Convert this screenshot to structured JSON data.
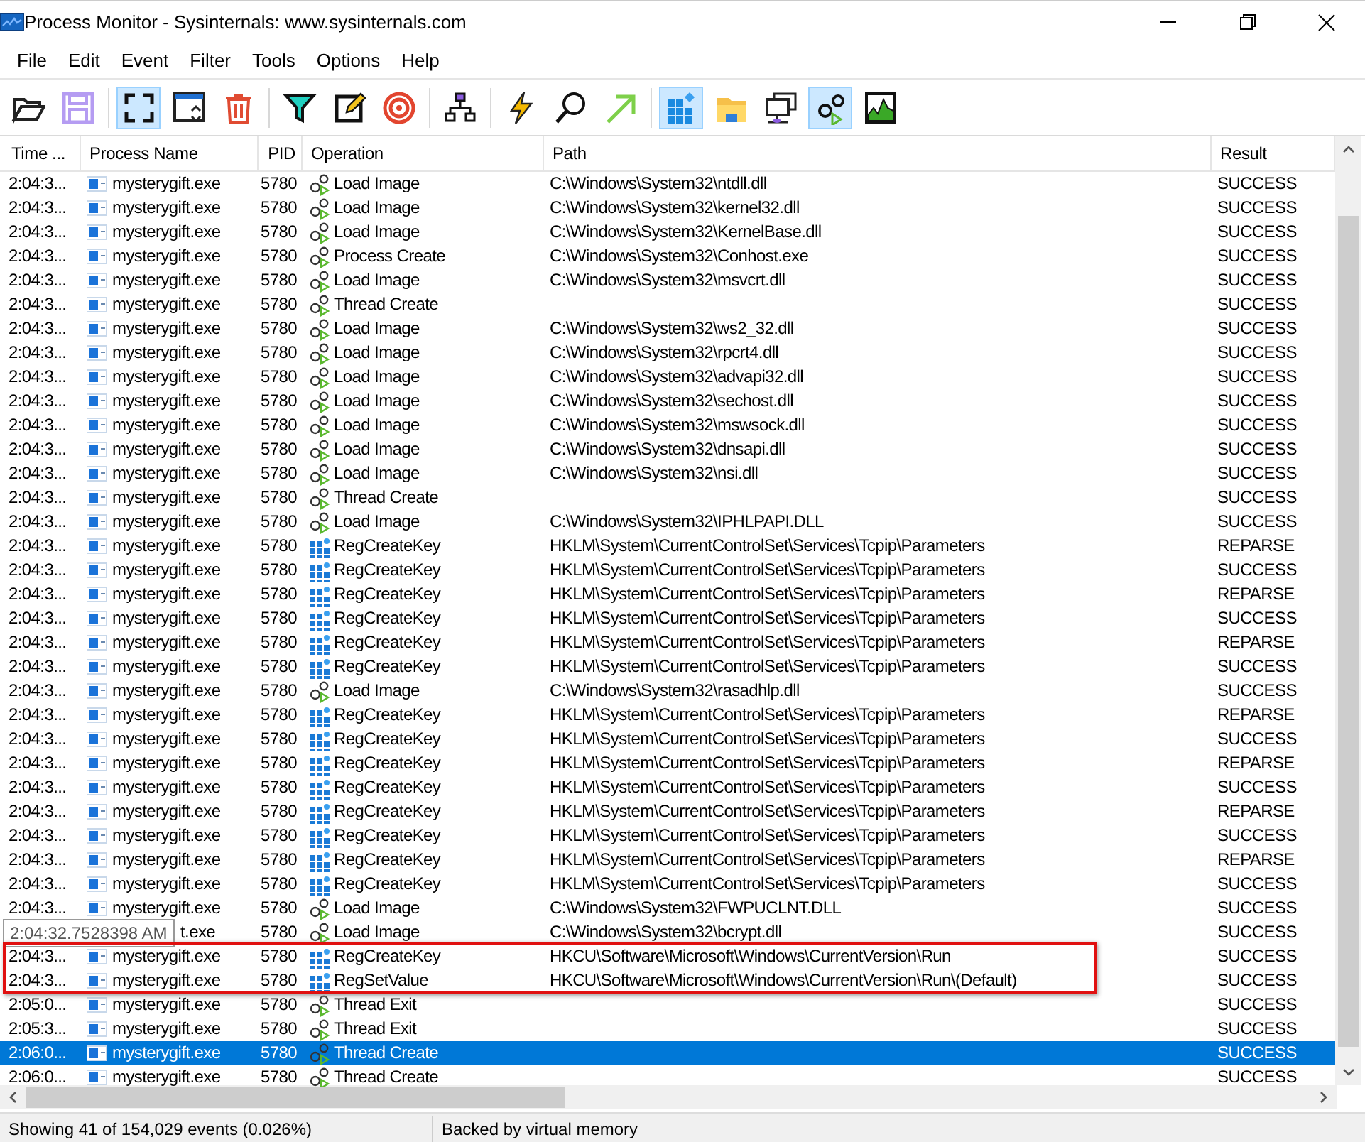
{
  "window": {
    "title": "Process Monitor - Sysinternals: www.sysinternals.com"
  },
  "menu": [
    "File",
    "Edit",
    "Event",
    "Filter",
    "Tools",
    "Options",
    "Help"
  ],
  "toolbar": [
    {
      "kind": "open",
      "pressed": false,
      "disabled": false
    },
    {
      "kind": "save",
      "pressed": false,
      "disabled": true
    },
    {
      "kind": "sep"
    },
    {
      "kind": "capture",
      "pressed": true,
      "disabled": false
    },
    {
      "kind": "autoscroll",
      "pressed": false,
      "disabled": false
    },
    {
      "kind": "clear",
      "pressed": false,
      "disabled": false
    },
    {
      "kind": "sep"
    },
    {
      "kind": "filter",
      "pressed": false,
      "disabled": false
    },
    {
      "kind": "highlight",
      "pressed": false,
      "disabled": false
    },
    {
      "kind": "target",
      "pressed": false,
      "disabled": false
    },
    {
      "kind": "sep"
    },
    {
      "kind": "tree",
      "pressed": false,
      "disabled": false
    },
    {
      "kind": "sep"
    },
    {
      "kind": "event",
      "pressed": false,
      "disabled": false
    },
    {
      "kind": "find",
      "pressed": false,
      "disabled": false
    },
    {
      "kind": "jump",
      "pressed": false,
      "disabled": false
    },
    {
      "kind": "sep"
    },
    {
      "kind": "registry",
      "pressed": true,
      "disabled": false
    },
    {
      "kind": "file",
      "pressed": false,
      "disabled": false
    },
    {
      "kind": "network",
      "pressed": false,
      "disabled": false
    },
    {
      "kind": "process",
      "pressed": true,
      "disabled": false
    },
    {
      "kind": "profiling",
      "pressed": false,
      "disabled": false
    }
  ],
  "table": {
    "columns": [
      "Time ...",
      "Process Name",
      "PID",
      "Operation",
      "Path",
      "Result"
    ],
    "rows": [
      {
        "time": "2:04:3...",
        "process": "mysterygift.exe",
        "pid": "5780",
        "kind": "process",
        "operation": "Load Image",
        "path": "C:\\Windows\\System32\\ntdll.dll",
        "result": "SUCCESS",
        "selected": false,
        "flagged": false
      },
      {
        "time": "2:04:3...",
        "process": "mysterygift.exe",
        "pid": "5780",
        "kind": "process",
        "operation": "Load Image",
        "path": "C:\\Windows\\System32\\kernel32.dll",
        "result": "SUCCESS",
        "selected": false,
        "flagged": false
      },
      {
        "time": "2:04:3...",
        "process": "mysterygift.exe",
        "pid": "5780",
        "kind": "process",
        "operation": "Load Image",
        "path": "C:\\Windows\\System32\\KernelBase.dll",
        "result": "SUCCESS",
        "selected": false,
        "flagged": false
      },
      {
        "time": "2:04:3...",
        "process": "mysterygift.exe",
        "pid": "5780",
        "kind": "process",
        "operation": "Process Create",
        "path": "C:\\Windows\\System32\\Conhost.exe",
        "result": "SUCCESS",
        "selected": false,
        "flagged": false
      },
      {
        "time": "2:04:3...",
        "process": "mysterygift.exe",
        "pid": "5780",
        "kind": "process",
        "operation": "Load Image",
        "path": "C:\\Windows\\System32\\msvcrt.dll",
        "result": "SUCCESS",
        "selected": false,
        "flagged": false
      },
      {
        "time": "2:04:3...",
        "process": "mysterygift.exe",
        "pid": "5780",
        "kind": "process",
        "operation": "Thread Create",
        "result": "SUCCESS",
        "selected": false,
        "flagged": false
      },
      {
        "time": "2:04:3...",
        "process": "mysterygift.exe",
        "pid": "5780",
        "kind": "process",
        "operation": "Load Image",
        "path": "C:\\Windows\\System32\\ws2_32.dll",
        "result": "SUCCESS",
        "selected": false,
        "flagged": false
      },
      {
        "time": "2:04:3...",
        "process": "mysterygift.exe",
        "pid": "5780",
        "kind": "process",
        "operation": "Load Image",
        "path": "C:\\Windows\\System32\\rpcrt4.dll",
        "result": "SUCCESS",
        "selected": false,
        "flagged": false
      },
      {
        "time": "2:04:3...",
        "process": "mysterygift.exe",
        "pid": "5780",
        "kind": "process",
        "operation": "Load Image",
        "path": "C:\\Windows\\System32\\advapi32.dll",
        "result": "SUCCESS",
        "selected": false,
        "flagged": false
      },
      {
        "time": "2:04:3...",
        "process": "mysterygift.exe",
        "pid": "5780",
        "kind": "process",
        "operation": "Load Image",
        "path": "C:\\Windows\\System32\\sechost.dll",
        "result": "SUCCESS",
        "selected": false,
        "flagged": false
      },
      {
        "time": "2:04:3...",
        "process": "mysterygift.exe",
        "pid": "5780",
        "kind": "process",
        "operation": "Load Image",
        "path": "C:\\Windows\\System32\\mswsock.dll",
        "result": "SUCCESS",
        "selected": false,
        "flagged": false
      },
      {
        "time": "2:04:3...",
        "process": "mysterygift.exe",
        "pid": "5780",
        "kind": "process",
        "operation": "Load Image",
        "path": "C:\\Windows\\System32\\dnsapi.dll",
        "result": "SUCCESS",
        "selected": false,
        "flagged": false
      },
      {
        "time": "2:04:3...",
        "process": "mysterygift.exe",
        "pid": "5780",
        "kind": "process",
        "operation": "Load Image",
        "path": "C:\\Windows\\System32\\nsi.dll",
        "result": "SUCCESS",
        "selected": false,
        "flagged": false
      },
      {
        "time": "2:04:3...",
        "process": "mysterygift.exe",
        "pid": "5780",
        "kind": "process",
        "operation": "Thread Create",
        "result": "SUCCESS",
        "selected": false,
        "flagged": false
      },
      {
        "time": "2:04:3...",
        "process": "mysterygift.exe",
        "pid": "5780",
        "kind": "process",
        "operation": "Load Image",
        "path": "C:\\Windows\\System32\\IPHLPAPI.DLL",
        "result": "SUCCESS",
        "selected": false,
        "flagged": false
      },
      {
        "time": "2:04:3...",
        "process": "mysterygift.exe",
        "pid": "5780",
        "kind": "registry",
        "operation": "RegCreateKey",
        "path": "HKLM\\System\\CurrentControlSet\\Services\\Tcpip\\Parameters",
        "result": "REPARSE",
        "selected": false,
        "flagged": false
      },
      {
        "time": "2:04:3...",
        "process": "mysterygift.exe",
        "pid": "5780",
        "kind": "registry",
        "operation": "RegCreateKey",
        "path": "HKLM\\System\\CurrentControlSet\\Services\\Tcpip\\Parameters",
        "result": "SUCCESS",
        "selected": false,
        "flagged": false
      },
      {
        "time": "2:04:3...",
        "process": "mysterygift.exe",
        "pid": "5780",
        "kind": "registry",
        "operation": "RegCreateKey",
        "path": "HKLM\\System\\CurrentControlSet\\Services\\Tcpip\\Parameters",
        "result": "REPARSE",
        "selected": false,
        "flagged": false
      },
      {
        "time": "2:04:3...",
        "process": "mysterygift.exe",
        "pid": "5780",
        "kind": "registry",
        "operation": "RegCreateKey",
        "path": "HKLM\\System\\CurrentControlSet\\Services\\Tcpip\\Parameters",
        "result": "SUCCESS",
        "selected": false,
        "flagged": false
      },
      {
        "time": "2:04:3...",
        "process": "mysterygift.exe",
        "pid": "5780",
        "kind": "registry",
        "operation": "RegCreateKey",
        "path": "HKLM\\System\\CurrentControlSet\\Services\\Tcpip\\Parameters",
        "result": "REPARSE",
        "selected": false,
        "flagged": false
      },
      {
        "time": "2:04:3...",
        "process": "mysterygift.exe",
        "pid": "5780",
        "kind": "registry",
        "operation": "RegCreateKey",
        "path": "HKLM\\System\\CurrentControlSet\\Services\\Tcpip\\Parameters",
        "result": "SUCCESS",
        "selected": false,
        "flagged": false
      },
      {
        "time": "2:04:3...",
        "process": "mysterygift.exe",
        "pid": "5780",
        "kind": "process",
        "operation": "Load Image",
        "path": "C:\\Windows\\System32\\rasadhlp.dll",
        "result": "SUCCESS",
        "selected": false,
        "flagged": false
      },
      {
        "time": "2:04:3...",
        "process": "mysterygift.exe",
        "pid": "5780",
        "kind": "registry",
        "operation": "RegCreateKey",
        "path": "HKLM\\System\\CurrentControlSet\\Services\\Tcpip\\Parameters",
        "result": "REPARSE",
        "selected": false,
        "flagged": false
      },
      {
        "time": "2:04:3...",
        "process": "mysterygift.exe",
        "pid": "5780",
        "kind": "registry",
        "operation": "RegCreateKey",
        "path": "HKLM\\System\\CurrentControlSet\\Services\\Tcpip\\Parameters",
        "result": "SUCCESS",
        "selected": false,
        "flagged": false
      },
      {
        "time": "2:04:3...",
        "process": "mysterygift.exe",
        "pid": "5780",
        "kind": "registry",
        "operation": "RegCreateKey",
        "path": "HKLM\\System\\CurrentControlSet\\Services\\Tcpip\\Parameters",
        "result": "REPARSE",
        "selected": false,
        "flagged": false
      },
      {
        "time": "2:04:3...",
        "process": "mysterygift.exe",
        "pid": "5780",
        "kind": "registry",
        "operation": "RegCreateKey",
        "path": "HKLM\\System\\CurrentControlSet\\Services\\Tcpip\\Parameters",
        "result": "SUCCESS",
        "selected": false,
        "flagged": false
      },
      {
        "time": "2:04:3...",
        "process": "mysterygift.exe",
        "pid": "5780",
        "kind": "registry",
        "operation": "RegCreateKey",
        "path": "HKLM\\System\\CurrentControlSet\\Services\\Tcpip\\Parameters",
        "result": "REPARSE",
        "selected": false,
        "flagged": false
      },
      {
        "time": "2:04:3...",
        "process": "mysterygift.exe",
        "pid": "5780",
        "kind": "registry",
        "operation": "RegCreateKey",
        "path": "HKLM\\System\\CurrentControlSet\\Services\\Tcpip\\Parameters",
        "result": "SUCCESS",
        "selected": false,
        "flagged": false
      },
      {
        "time": "2:04:3...",
        "process": "mysterygift.exe",
        "pid": "5780",
        "kind": "registry",
        "operation": "RegCreateKey",
        "path": "HKLM\\System\\CurrentControlSet\\Services\\Tcpip\\Parameters",
        "result": "REPARSE",
        "selected": false,
        "flagged": false
      },
      {
        "time": "2:04:3...",
        "process": "mysterygift.exe",
        "pid": "5780",
        "kind": "registry",
        "operation": "RegCreateKey",
        "path": "HKLM\\System\\CurrentControlSet\\Services\\Tcpip\\Parameters",
        "result": "SUCCESS",
        "selected": false,
        "flagged": false
      },
      {
        "time": "2:04:3...",
        "process": "mysterygift.exe",
        "pid": "5780",
        "kind": "process",
        "operation": "Load Image",
        "path": "C:\\Windows\\System32\\FWPUCLNT.DLL",
        "result": "SUCCESS",
        "selected": false,
        "flagged": false
      },
      {
        "tooltip": "2:04:32.7528398 AM",
        "process": "t.exe",
        "pid": "5780",
        "kind": "process",
        "operation": "Load Image",
        "path": "C:\\Windows\\System32\\bcrypt.dll",
        "result": "SUCCESS",
        "selected": false,
        "flagged": false
      },
      {
        "time": "2:04:3...",
        "process": "mysterygift.exe",
        "pid": "5780",
        "kind": "registry",
        "operation": "RegCreateKey",
        "path": "HKCU\\Software\\Microsoft\\Windows\\CurrentVersion\\Run",
        "result": "SUCCESS",
        "selected": false,
        "flagged": true
      },
      {
        "time": "2:04:3...",
        "process": "mysterygift.exe",
        "pid": "5780",
        "kind": "registry",
        "operation": "RegSetValue",
        "path": "HKCU\\Software\\Microsoft\\Windows\\CurrentVersion\\Run\\(Default)",
        "result": "SUCCESS",
        "selected": false,
        "flagged": true
      },
      {
        "time": "2:05:0...",
        "process": "mysterygift.exe",
        "pid": "5780",
        "kind": "process",
        "operation": "Thread Exit",
        "result": "SUCCESS",
        "selected": false,
        "flagged": false
      },
      {
        "time": "2:05:3...",
        "process": "mysterygift.exe",
        "pid": "5780",
        "kind": "process",
        "operation": "Thread Exit",
        "result": "SUCCESS",
        "selected": false,
        "flagged": false
      },
      {
        "time": "2:06:0...",
        "process": "mysterygift.exe",
        "pid": "5780",
        "kind": "process",
        "operation": "Thread Create",
        "result": "SUCCESS",
        "selected": true,
        "flagged": false
      },
      {
        "time": "2:06:0...",
        "process": "mysterygift.exe",
        "pid": "5780",
        "kind": "process",
        "operation": "Thread Create",
        "result": "SUCCESS",
        "selected": false,
        "flagged": false
      }
    ]
  },
  "status_bar": [
    "Showing 41 of 154,029 events (0.026%)",
    "Backed by virtual memory"
  ]
}
